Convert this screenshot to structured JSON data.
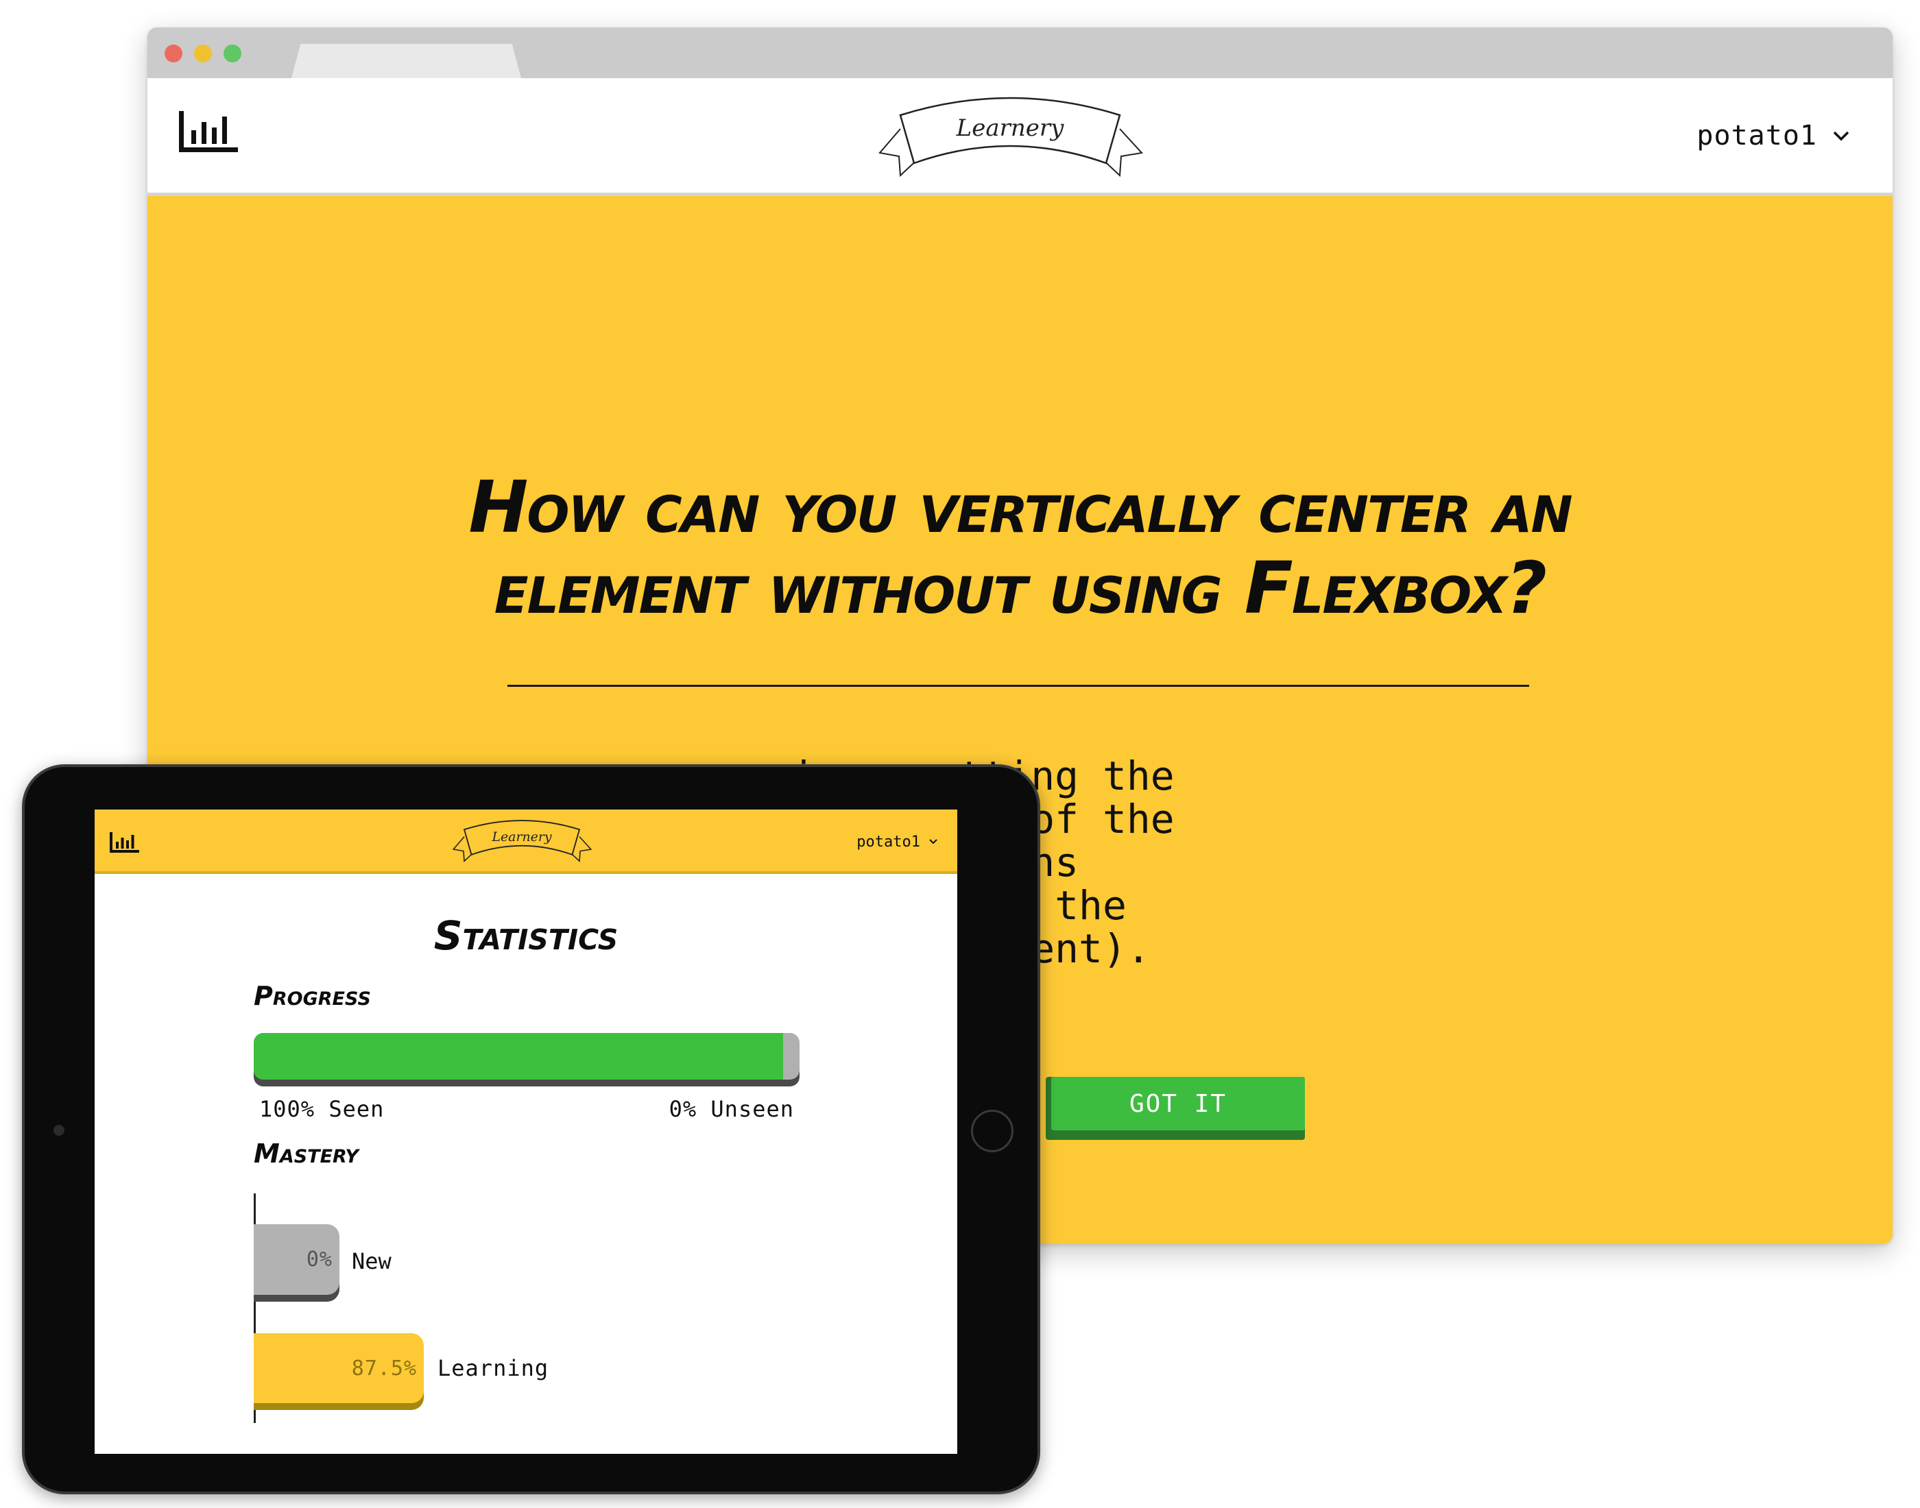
{
  "browser": {
    "logo_text": "Learnery",
    "username": "potato1",
    "question": "How can you vertically center an element without using Flexbox?",
    "answer_lines": [
      "            ing, setting the",
      "           the height of the",
      "          clever margins",
      "          ires knowing the",
      "         s of the element)."
    ],
    "answer_text": "            ing, setting the\n           the height of the\n          clever margins\n          ires knowing the\n         s of the element).",
    "got_it_label": "GOT IT",
    "colors": {
      "accent_yellow": "#fdc935",
      "button_green": "#3dbd3f"
    }
  },
  "tablet": {
    "logo_text": "Learnery",
    "username": "potato1",
    "statistics_title": "Statistics",
    "progress": {
      "title": "Progress",
      "seen_fraction": 0.97,
      "seen_label": "100% Seen",
      "unseen_label": "0% Unseen"
    },
    "mastery": {
      "title": "Mastery",
      "items": [
        {
          "label": "New",
          "percent_label": "0%",
          "color": "#b2b2b2"
        },
        {
          "label": "Learning",
          "percent_label": "87.5%",
          "color": "#fdc935"
        }
      ]
    }
  }
}
